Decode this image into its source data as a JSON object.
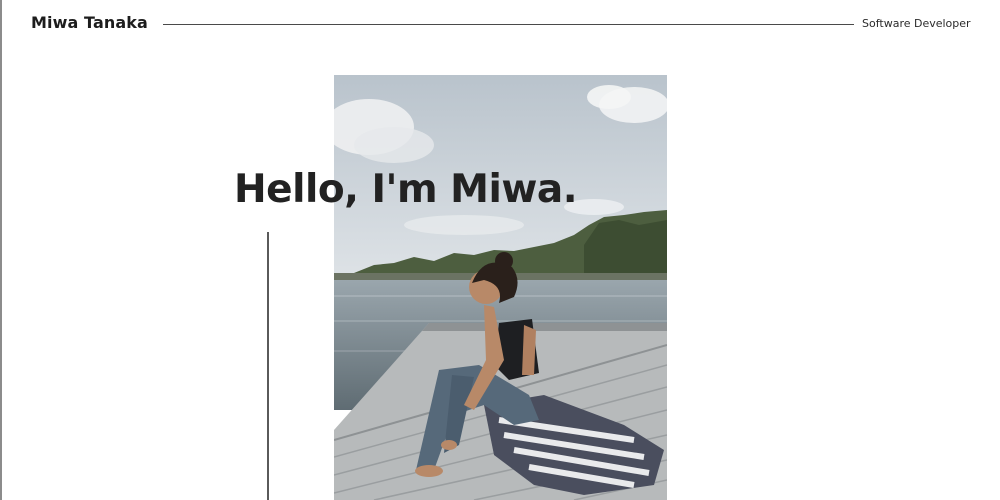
{
  "header": {
    "name": "Miwa Tanaka",
    "role": "Software Developer"
  },
  "hero": {
    "greeting": "Hello, I'm Miwa.",
    "photo": {
      "subject": "photo-woman-sitting-on-dock-by-lake",
      "colors": {
        "sky": "#c9d0d6",
        "water": "#7f8b93",
        "trees": "#46583a",
        "dock": "#b9bcbd",
        "towel": "#4a4e5e"
      }
    }
  }
}
